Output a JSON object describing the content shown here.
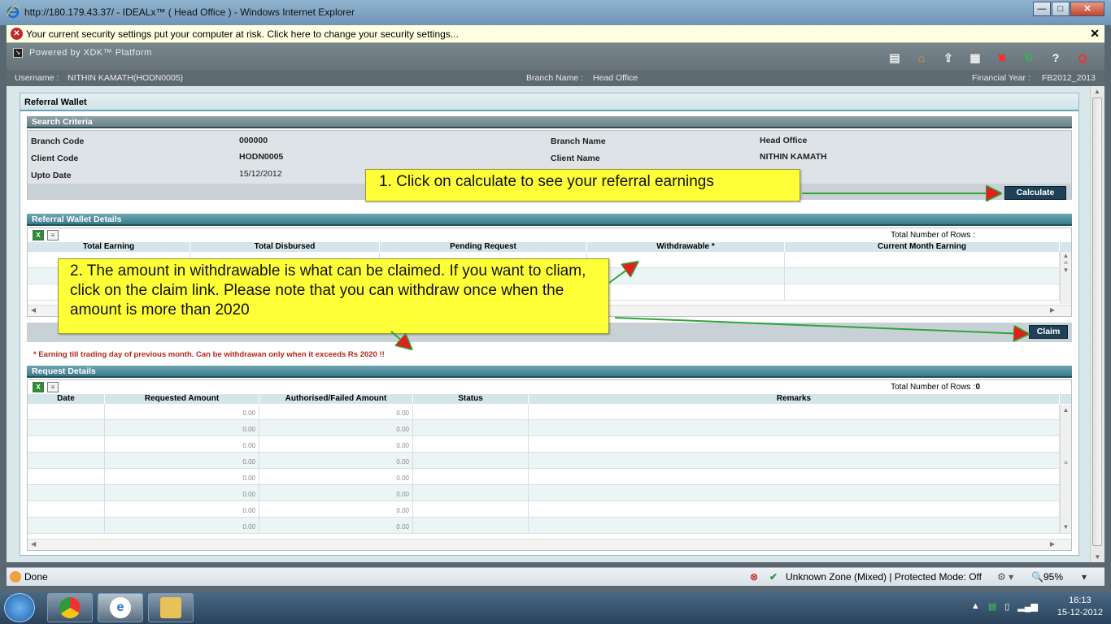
{
  "window": {
    "title": "http://180.179.43.37/ - IDEALx™ ( Head Office ) - Windows Internet Explorer",
    "min": "—",
    "max": "□",
    "close": "✕"
  },
  "security_bar": {
    "message": "Your current security settings put your computer at risk. Click here to change your security settings...",
    "close": "✕"
  },
  "app": {
    "powered_by": "Powered by XDK™ Platform",
    "toolbar_icons": [
      "report-icon",
      "home-icon",
      "upload-icon",
      "calendar-icon",
      "stop-icon",
      "refresh-icon",
      "help-icon",
      "logout-icon"
    ]
  },
  "user": {
    "username_label": "Username :",
    "username": "NITHIN KAMATH(HODN0005)",
    "branch_label": "Branch Name :",
    "branch": "Head Office",
    "fy_label": "Financial Year :",
    "fy": "FB2012_2013"
  },
  "page": {
    "title": "Referral Wallet",
    "search_criteria": {
      "header": "Search Criteria",
      "branch_code_label": "Branch Code",
      "branch_code": "000000",
      "client_code_label": "Client Code",
      "client_code": "HODN0005",
      "upto_date_label": "Upto Date",
      "upto_date": "15/12/2012",
      "branch_name_label": "Branch Name",
      "branch_name": "Head Office",
      "client_name_label": "Client Name",
      "client_name": "NITHIN KAMATH",
      "calculate": "Calculate"
    },
    "wallet": {
      "header": "Referral Wallet Details",
      "rows_label": "Total Number of Rows :",
      "columns": [
        "Total Earning",
        "Total Disbursed",
        "Pending Request",
        "Withdrawable *",
        "Current Month Earning"
      ],
      "claim": "Claim",
      "note": "* Earning till trading day of previous month. Can be withdrawan only when it exceeds Rs 2020 !!"
    },
    "requests": {
      "header": "Request Details",
      "rows_label": "Total Number of Rows :",
      "rows_count": "0",
      "columns": [
        "Date",
        "Requested Amount",
        "Authorised/Failed Amount",
        "Status",
        "Remarks"
      ],
      "rows": [
        [
          "",
          "0.00",
          "0.00",
          "",
          ""
        ],
        [
          "",
          "0.00",
          "0.00",
          "",
          ""
        ],
        [
          "",
          "0.00",
          "0.00",
          "",
          ""
        ],
        [
          "",
          "0.00",
          "0.00",
          "",
          ""
        ],
        [
          "",
          "0.00",
          "0.00",
          "",
          ""
        ],
        [
          "",
          "0.00",
          "0.00",
          "",
          ""
        ],
        [
          "",
          "0.00",
          "0.00",
          "",
          ""
        ],
        [
          "",
          "0.00",
          "0.00",
          "",
          ""
        ]
      ]
    }
  },
  "callouts": {
    "one": "1. Click on calculate to see your referral earnings",
    "two": "2. The amount in withdrawable is what can be claimed. If you want to cliam, click on the claim link. Please note that you can withdraw once when the amount is more than 2020"
  },
  "status": {
    "done": "Done",
    "zone": "Unknown Zone (Mixed) | Protected Mode: Off",
    "zoom": "95%"
  },
  "clock": {
    "time": "16:13",
    "date": "15-12-2012"
  },
  "colors": {
    "arrow": "#2fa53a",
    "arrowhead": "#e0201a",
    "callout": "#ffff38",
    "button": "#1d4257"
  }
}
